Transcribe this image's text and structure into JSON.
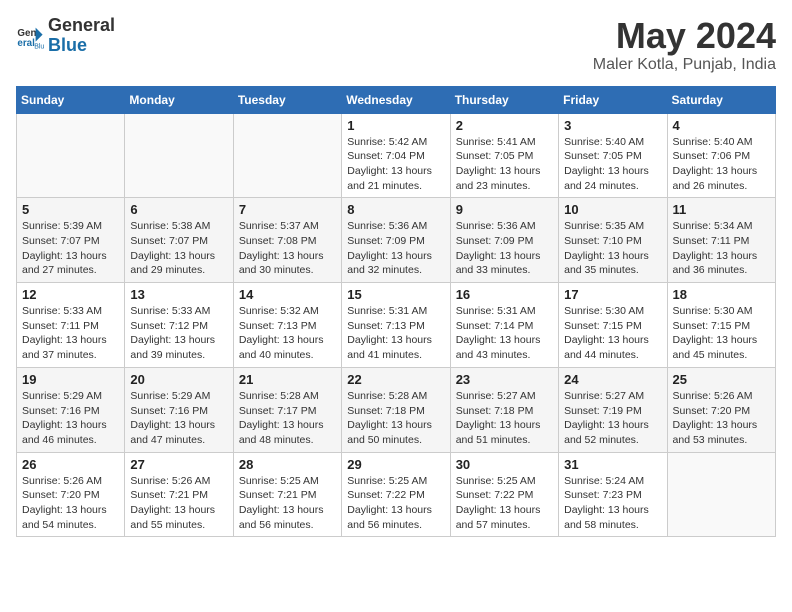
{
  "header": {
    "logo_general": "General",
    "logo_blue": "Blue",
    "month_title": "May 2024",
    "location": "Maler Kotla, Punjab, India"
  },
  "calendar": {
    "days_of_week": [
      "Sunday",
      "Monday",
      "Tuesday",
      "Wednesday",
      "Thursday",
      "Friday",
      "Saturday"
    ],
    "weeks": [
      [
        {
          "day": "",
          "info": ""
        },
        {
          "day": "",
          "info": ""
        },
        {
          "day": "",
          "info": ""
        },
        {
          "day": "1",
          "info": "Sunrise: 5:42 AM\nSunset: 7:04 PM\nDaylight: 13 hours\nand 21 minutes."
        },
        {
          "day": "2",
          "info": "Sunrise: 5:41 AM\nSunset: 7:05 PM\nDaylight: 13 hours\nand 23 minutes."
        },
        {
          "day": "3",
          "info": "Sunrise: 5:40 AM\nSunset: 7:05 PM\nDaylight: 13 hours\nand 24 minutes."
        },
        {
          "day": "4",
          "info": "Sunrise: 5:40 AM\nSunset: 7:06 PM\nDaylight: 13 hours\nand 26 minutes."
        }
      ],
      [
        {
          "day": "5",
          "info": "Sunrise: 5:39 AM\nSunset: 7:07 PM\nDaylight: 13 hours\nand 27 minutes."
        },
        {
          "day": "6",
          "info": "Sunrise: 5:38 AM\nSunset: 7:07 PM\nDaylight: 13 hours\nand 29 minutes."
        },
        {
          "day": "7",
          "info": "Sunrise: 5:37 AM\nSunset: 7:08 PM\nDaylight: 13 hours\nand 30 minutes."
        },
        {
          "day": "8",
          "info": "Sunrise: 5:36 AM\nSunset: 7:09 PM\nDaylight: 13 hours\nand 32 minutes."
        },
        {
          "day": "9",
          "info": "Sunrise: 5:36 AM\nSunset: 7:09 PM\nDaylight: 13 hours\nand 33 minutes."
        },
        {
          "day": "10",
          "info": "Sunrise: 5:35 AM\nSunset: 7:10 PM\nDaylight: 13 hours\nand 35 minutes."
        },
        {
          "day": "11",
          "info": "Sunrise: 5:34 AM\nSunset: 7:11 PM\nDaylight: 13 hours\nand 36 minutes."
        }
      ],
      [
        {
          "day": "12",
          "info": "Sunrise: 5:33 AM\nSunset: 7:11 PM\nDaylight: 13 hours\nand 37 minutes."
        },
        {
          "day": "13",
          "info": "Sunrise: 5:33 AM\nSunset: 7:12 PM\nDaylight: 13 hours\nand 39 minutes."
        },
        {
          "day": "14",
          "info": "Sunrise: 5:32 AM\nSunset: 7:13 PM\nDaylight: 13 hours\nand 40 minutes."
        },
        {
          "day": "15",
          "info": "Sunrise: 5:31 AM\nSunset: 7:13 PM\nDaylight: 13 hours\nand 41 minutes."
        },
        {
          "day": "16",
          "info": "Sunrise: 5:31 AM\nSunset: 7:14 PM\nDaylight: 13 hours\nand 43 minutes."
        },
        {
          "day": "17",
          "info": "Sunrise: 5:30 AM\nSunset: 7:15 PM\nDaylight: 13 hours\nand 44 minutes."
        },
        {
          "day": "18",
          "info": "Sunrise: 5:30 AM\nSunset: 7:15 PM\nDaylight: 13 hours\nand 45 minutes."
        }
      ],
      [
        {
          "day": "19",
          "info": "Sunrise: 5:29 AM\nSunset: 7:16 PM\nDaylight: 13 hours\nand 46 minutes."
        },
        {
          "day": "20",
          "info": "Sunrise: 5:29 AM\nSunset: 7:16 PM\nDaylight: 13 hours\nand 47 minutes."
        },
        {
          "day": "21",
          "info": "Sunrise: 5:28 AM\nSunset: 7:17 PM\nDaylight: 13 hours\nand 48 minutes."
        },
        {
          "day": "22",
          "info": "Sunrise: 5:28 AM\nSunset: 7:18 PM\nDaylight: 13 hours\nand 50 minutes."
        },
        {
          "day": "23",
          "info": "Sunrise: 5:27 AM\nSunset: 7:18 PM\nDaylight: 13 hours\nand 51 minutes."
        },
        {
          "day": "24",
          "info": "Sunrise: 5:27 AM\nSunset: 7:19 PM\nDaylight: 13 hours\nand 52 minutes."
        },
        {
          "day": "25",
          "info": "Sunrise: 5:26 AM\nSunset: 7:20 PM\nDaylight: 13 hours\nand 53 minutes."
        }
      ],
      [
        {
          "day": "26",
          "info": "Sunrise: 5:26 AM\nSunset: 7:20 PM\nDaylight: 13 hours\nand 54 minutes."
        },
        {
          "day": "27",
          "info": "Sunrise: 5:26 AM\nSunset: 7:21 PM\nDaylight: 13 hours\nand 55 minutes."
        },
        {
          "day": "28",
          "info": "Sunrise: 5:25 AM\nSunset: 7:21 PM\nDaylight: 13 hours\nand 56 minutes."
        },
        {
          "day": "29",
          "info": "Sunrise: 5:25 AM\nSunset: 7:22 PM\nDaylight: 13 hours\nand 56 minutes."
        },
        {
          "day": "30",
          "info": "Sunrise: 5:25 AM\nSunset: 7:22 PM\nDaylight: 13 hours\nand 57 minutes."
        },
        {
          "day": "31",
          "info": "Sunrise: 5:24 AM\nSunset: 7:23 PM\nDaylight: 13 hours\nand 58 minutes."
        },
        {
          "day": "",
          "info": ""
        }
      ]
    ]
  }
}
